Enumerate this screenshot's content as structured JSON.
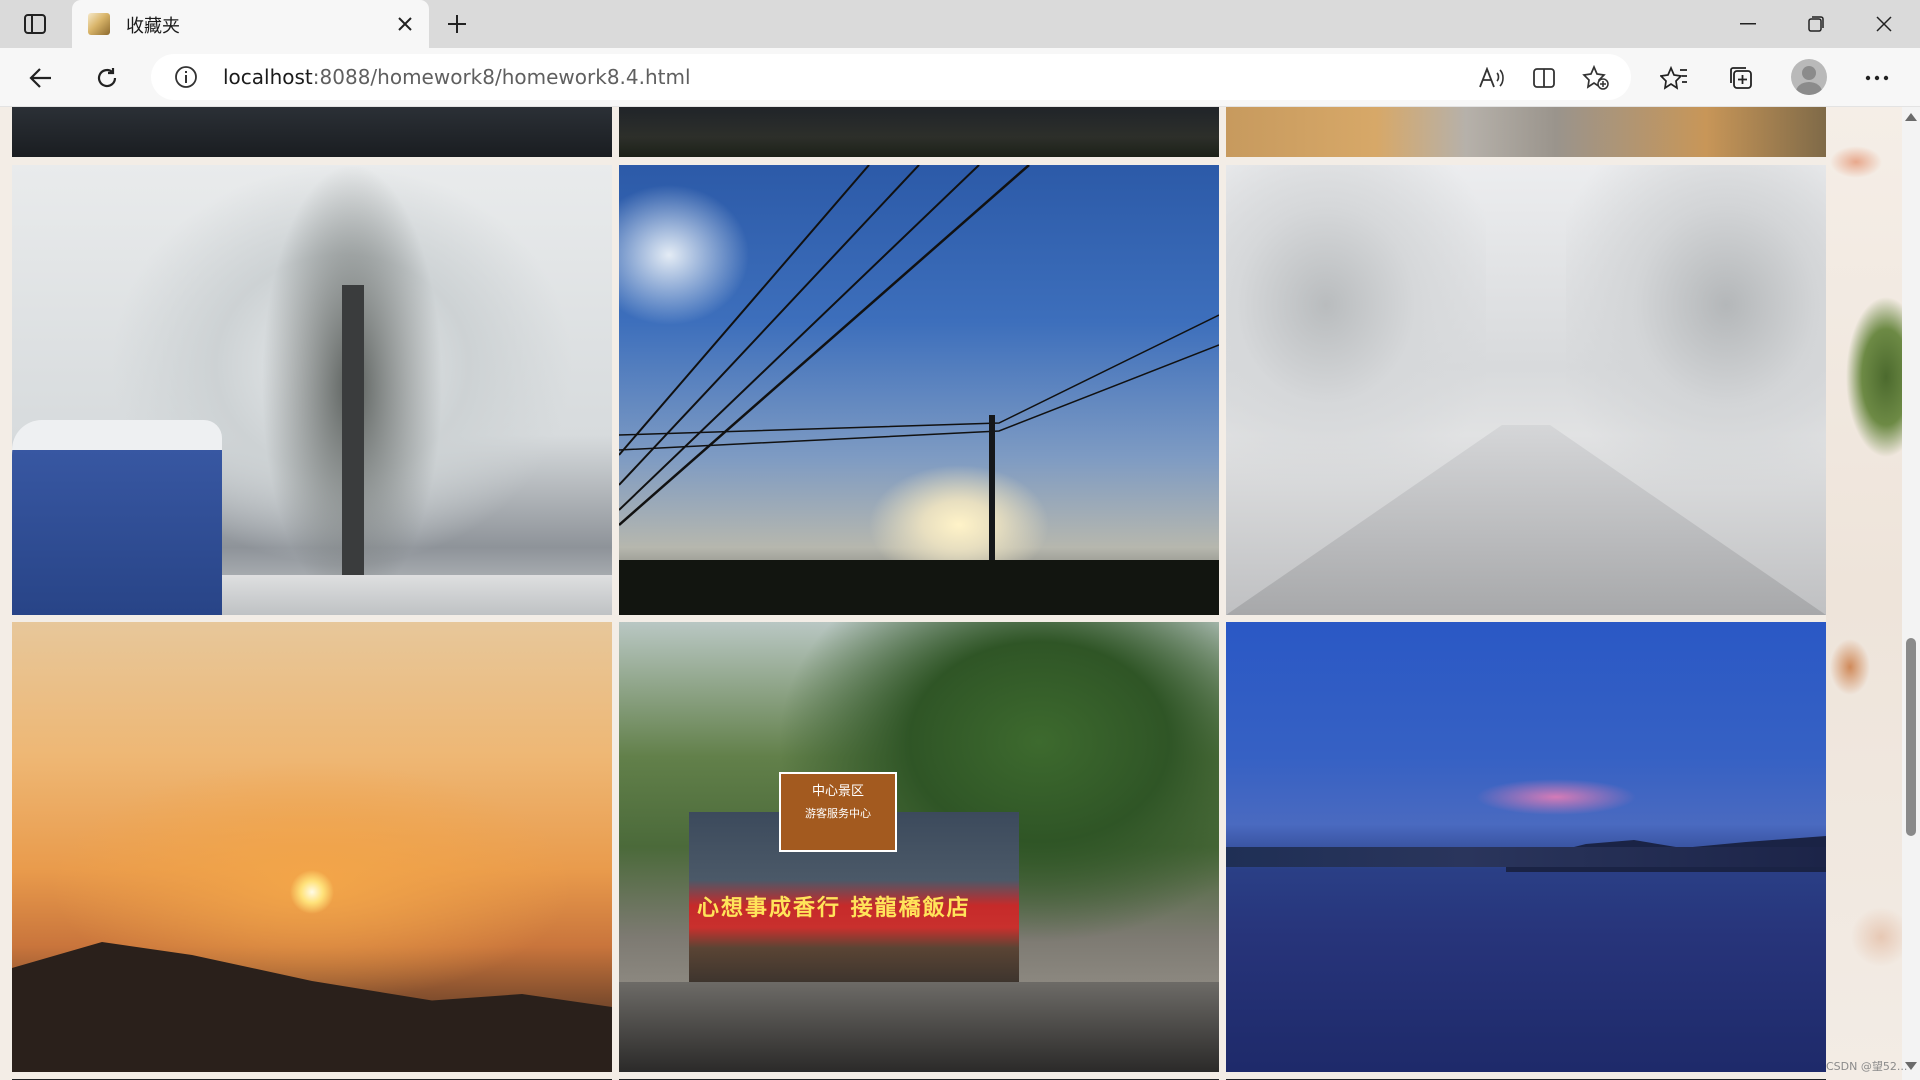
{
  "tab": {
    "title": "收藏夹",
    "close_icon": "close-icon",
    "new_tab_icon": "plus-icon"
  },
  "address_bar": {
    "url_host": "localhost",
    "url_rest": ":8088/homework8/homework8.4.html",
    "site_info_icon": "info-icon"
  },
  "toolbar": {
    "icons": [
      "back-arrow-icon",
      "refresh-icon",
      "read-aloud-icon",
      "split-screen-icon",
      "add-favorite-icon",
      "favorites-icon",
      "collections-icon",
      "profile-avatar-icon",
      "more-icon"
    ]
  },
  "window_controls": [
    "minimize-icon",
    "restore-icon",
    "close-window-icon"
  ],
  "gallery": {
    "photos": [
      {
        "name": "city-buildings-dusk"
      },
      {
        "name": "night-town"
      },
      {
        "name": "building-sunset-sky"
      },
      {
        "name": "snow-covered-tree"
      },
      {
        "name": "blue-sky-power-lines"
      },
      {
        "name": "snowy-tree-lined-road"
      },
      {
        "name": "orange-sunset-hills"
      },
      {
        "name": "street-shops-crowd"
      },
      {
        "name": "river-evening-blue"
      }
    ],
    "street_sign": "中心景区",
    "street_sign_sub": "游客服务中心",
    "shop_banner": "心想事成香行 接龍橋飯店"
  },
  "watermark": "CSDN @望52..."
}
